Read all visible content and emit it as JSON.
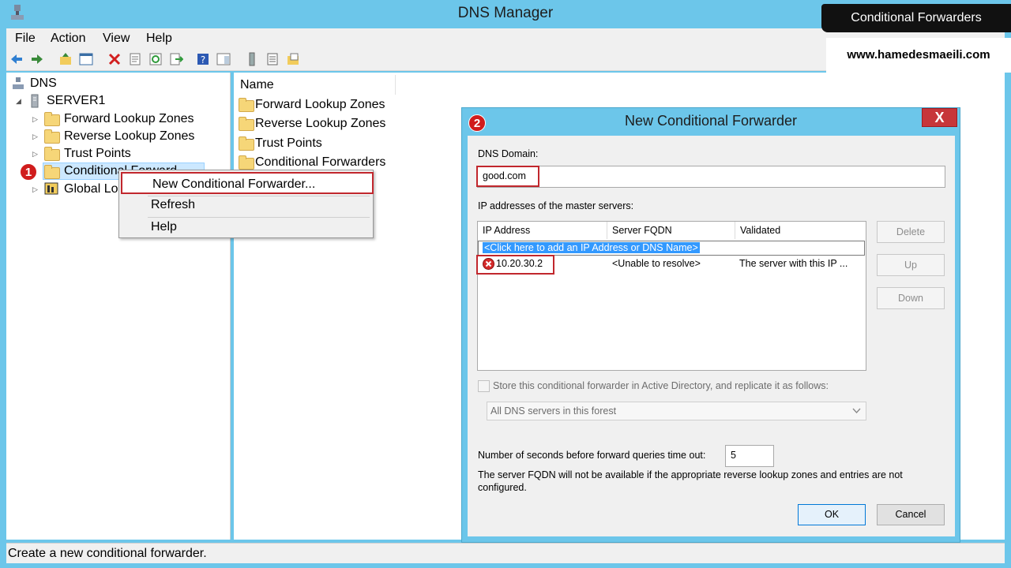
{
  "app": {
    "title": "DNS Manager"
  },
  "menubar": {
    "items": [
      "File",
      "Action",
      "View",
      "Help"
    ]
  },
  "tree": {
    "root": "DNS",
    "server": "SERVER1",
    "items": [
      "Forward Lookup Zones",
      "Reverse Lookup Zones",
      "Trust Points",
      "Conditional Forward",
      "Global Lo"
    ]
  },
  "list": {
    "column_name": "Name",
    "rows": [
      "Forward Lookup Zones",
      "Reverse Lookup Zones",
      "Trust Points",
      "Conditional Forwarders"
    ]
  },
  "context_menu": {
    "items": [
      "New Conditional Forwarder...",
      "Refresh",
      "Help"
    ]
  },
  "status": {
    "text": "Create a new conditional forwarder."
  },
  "badges": {
    "one": "1",
    "two": "2"
  },
  "dialog": {
    "title": "New Conditional Forwarder",
    "close_label": "X",
    "dns_domain_label": "DNS Domain:",
    "dns_domain_value": "good.com",
    "ip_label": "IP addresses of the master servers:",
    "columns": [
      "IP Address",
      "Server FQDN",
      "Validated"
    ],
    "add_row_text": "<Click here to add an IP Address or DNS Name>",
    "rows": [
      {
        "ip": "10.20.30.2",
        "fqdn": "<Unable to resolve>",
        "validated": "The server with this IP ..."
      }
    ],
    "delete_label": "Delete",
    "up_label": "Up",
    "down_label": "Down",
    "store_label": "Store this conditional forwarder in Active Directory, and replicate it as follows:",
    "replicate_value": "All DNS servers in this forest",
    "timeout_label": "Number of seconds before forward queries time out:",
    "timeout_value": "5",
    "note": "The server FQDN will not be available if the appropriate reverse lookup zones and entries are not configured.",
    "ok_label": "OK",
    "cancel_label": "Cancel"
  },
  "watermark": {
    "line1": "Conditional Forwarders",
    "line2": "www.hamedesmaeili.com"
  },
  "colors": {
    "titlebar": "#6cc6ea",
    "highlight": "#c1272d",
    "selection": "#3399ff"
  }
}
